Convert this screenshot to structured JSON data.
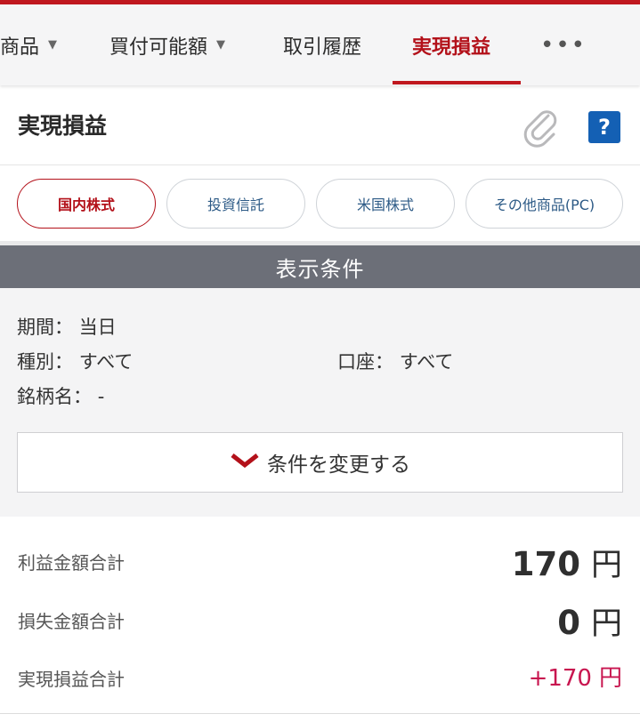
{
  "nav": {
    "items": [
      {
        "label": "商品",
        "caret": "▼"
      },
      {
        "label": "買付可能額",
        "caret": "▼"
      },
      {
        "label": "取引履歴"
      },
      {
        "label": "実現損益"
      }
    ],
    "more": "•••",
    "active_color": "#c0181f"
  },
  "page": {
    "title": "実現損益",
    "help": "?",
    "icons": [
      "paperclip-icon",
      "help-icon"
    ]
  },
  "tabs": [
    {
      "label": "国内株式",
      "active": true
    },
    {
      "label": "投資信託"
    },
    {
      "label": "米国株式"
    },
    {
      "label": "その他商品(PC)"
    }
  ],
  "conditions": {
    "header": "表示条件",
    "period_label": "期間：",
    "period_value": "当日",
    "type_label": "種別：",
    "type_value": "すべて",
    "account_label": "口座：",
    "account_value": "すべて",
    "name_label": "銘柄名：",
    "name_value": "-",
    "change_button": "条件を変更する"
  },
  "totals": {
    "gain_label": "利益金額合計",
    "gain_value": "170",
    "loss_label": "損失金額合計",
    "loss_value": "0",
    "net_label": "実現損益合計",
    "net_value": "+170",
    "unit": "円",
    "net_color": "#c8154f"
  }
}
